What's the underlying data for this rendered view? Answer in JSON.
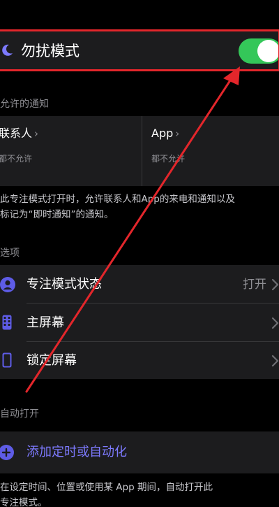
{
  "focus": {
    "title": "勿扰模式",
    "enabled": true
  },
  "allowed": {
    "header": "允许的通知",
    "people": {
      "label": "联系人",
      "sub": "都不允许"
    },
    "apps": {
      "label": "App",
      "sub": "都不允许"
    },
    "footnote_line1": "此专注模式打开时，允许联系人和App的来电和通知以及",
    "footnote_line2": "标记为“即时通知”的通知。"
  },
  "options": {
    "header": "选项",
    "items": [
      {
        "label": "专注模式状态",
        "value": "打开",
        "icon": "person-circle-icon"
      },
      {
        "label": "主屏幕",
        "value": "",
        "icon": "phone-home-screen-icon"
      },
      {
        "label": "锁定屏幕",
        "value": "",
        "icon": "phone-lock-screen-icon"
      }
    ]
  },
  "auto_on": {
    "header": "自动打开",
    "add_label": "添加定时或自动化",
    "footnote_line1": "在设定时间、位置或使用某 App 期间，自动打开此",
    "footnote_line2": "专注模式。"
  },
  "colors": {
    "accent": "#7d7aff",
    "toggle_on": "#34c759",
    "annotation": "#e3262b"
  }
}
